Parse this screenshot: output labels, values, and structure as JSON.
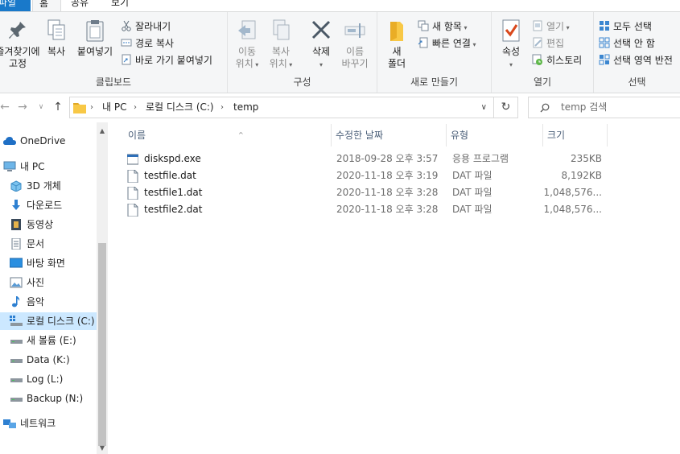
{
  "tabs": {
    "file": "파일",
    "home": "홈",
    "share": "공유",
    "view": "보기"
  },
  "ribbon": {
    "clipboard": {
      "pin_label_line1": "즐겨찾기에",
      "pin_label_line2": "고정",
      "copy": "복사",
      "paste": "붙여넣기",
      "cut": "잘라내기",
      "copy_path": "경로 복사",
      "paste_shortcut": "바로 가기 붙여넣기",
      "group": "클립보드"
    },
    "organize": {
      "move_to_line1": "이동",
      "move_to_line2": "위치",
      "copy_to_line1": "복사",
      "copy_to_line2": "위치",
      "delete": "삭제",
      "rename_line1": "이름",
      "rename_line2": "바꾸기",
      "group": "구성"
    },
    "new": {
      "new_folder_line1": "새",
      "new_folder_line2": "폴더",
      "new_item": "새 항목",
      "easy_access": "빠른 연결",
      "group": "새로 만들기"
    },
    "open": {
      "properties": "속성",
      "open": "열기",
      "edit": "편집",
      "history": "히스토리",
      "group": "열기"
    },
    "select": {
      "select_all": "모두 선택",
      "select_none": "선택 안 함",
      "invert": "선택 영역 반전",
      "group": "선택"
    }
  },
  "address": {
    "crumbs": [
      "내 PC",
      "로컬 디스크 (C:)",
      "temp"
    ],
    "search_placeholder": "temp 검색"
  },
  "nav": {
    "items": [
      {
        "label": "OneDrive",
        "icon": "cloud-icon"
      },
      {
        "label": "내 PC",
        "icon": "computer-icon"
      },
      {
        "label": "3D 개체",
        "icon": "cube-icon"
      },
      {
        "label": "다운로드",
        "icon": "download-arrow-icon"
      },
      {
        "label": "동영상",
        "icon": "film-icon"
      },
      {
        "label": "문서",
        "icon": "document-icon"
      },
      {
        "label": "바탕 화면",
        "icon": "desktop-icon"
      },
      {
        "label": "사진",
        "icon": "picture-icon"
      },
      {
        "label": "음악",
        "icon": "music-note-icon"
      },
      {
        "label": "로컬 디스크 (C:)",
        "icon": "windows-drive-icon"
      },
      {
        "label": "새 볼륨 (E:)",
        "icon": "drive-icon"
      },
      {
        "label": "Data (K:)",
        "icon": "drive-icon"
      },
      {
        "label": "Log (L:)",
        "icon": "drive-icon"
      },
      {
        "label": "Backup (N:)",
        "icon": "drive-icon"
      },
      {
        "label": "네트워크",
        "icon": "network-icon"
      }
    ]
  },
  "columns": {
    "name": "이름",
    "modified": "수정한 날짜",
    "type": "유형",
    "size": "크기"
  },
  "files": [
    {
      "name": "diskspd.exe",
      "modified": "2018-09-28 오후 3:57",
      "type": "응용 프로그램",
      "size": "235KB",
      "icon": "application-icon"
    },
    {
      "name": "testfile.dat",
      "modified": "2020-11-18 오후 3:19",
      "type": "DAT 파일",
      "size": "8,192KB",
      "icon": "file-icon"
    },
    {
      "name": "testfile1.dat",
      "modified": "2020-11-18 오후 3:28",
      "type": "DAT 파일",
      "size": "1,048,576...",
      "icon": "file-icon"
    },
    {
      "name": "testfile2.dat",
      "modified": "2020-11-18 오후 3:28",
      "type": "DAT 파일",
      "size": "1,048,576...",
      "icon": "file-icon"
    }
  ],
  "colors": {
    "accent": "#1979ca",
    "selection": "#cce8ff",
    "folder": "#f8c846"
  }
}
